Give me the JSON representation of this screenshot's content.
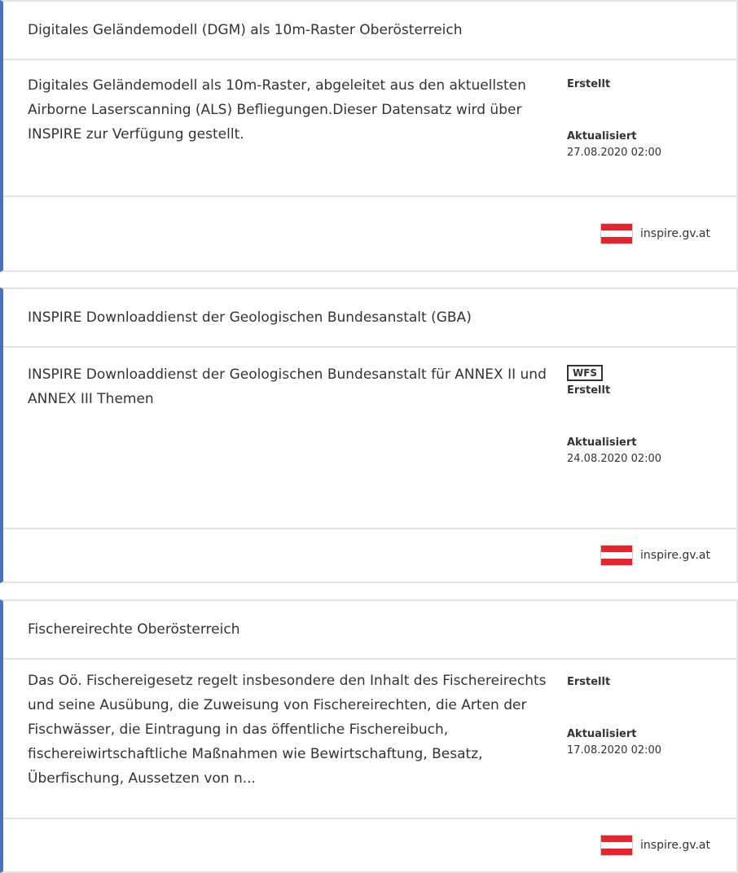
{
  "cards": [
    {
      "title": "Digitales Geländemodell (DGM) als 10m-Raster Oberösterreich",
      "description": "Digitales Geländemodell als 10m-Raster, abgeleitet aus den aktuellsten Airborne Laserscanning (ALS) Befliegungen.Dieser Datensatz wird über INSPIRE zur Verfügung gestellt.",
      "badge": "",
      "created_label": "Erstellt",
      "created_value": "",
      "updated_label": "Aktualisiert",
      "updated_value": "27.08.2020 02:00",
      "source": "inspire.gv.at",
      "flag_icon": "austria-flag-icon"
    },
    {
      "title": "INSPIRE Downloaddienst der Geologischen Bundesanstalt (GBA)",
      "description": "INSPIRE Downloaddienst der Geologischen Bundesanstalt für ANNEX II und ANNEX III Themen",
      "badge": "WFS",
      "created_label": "Erstellt",
      "created_value": "",
      "updated_label": "Aktualisiert",
      "updated_value": "24.08.2020 02:00",
      "source": "inspire.gv.at",
      "flag_icon": "austria-flag-icon"
    },
    {
      "title": "Fischereirechte Oberösterreich",
      "description": "Das Oö. Fischereigesetz regelt insbesondere den Inhalt des Fischereirechts und seine Ausübung, die Zuweisung von Fischereirechten, die Arten der Fischwässer, die Eintragung in das öffentliche Fischereibuch, fischereiwirtschaftliche Maßnahmen wie Bewirtschaftung, Besatz, Überfischung, Aussetzen von n...",
      "badge": "",
      "created_label": "Erstellt",
      "created_value": "",
      "updated_label": "Aktualisiert",
      "updated_value": "17.08.2020 02:00",
      "source": "inspire.gv.at",
      "flag_icon": "austria-flag-icon"
    }
  ],
  "colors": {
    "accent_border": "#4a72c0",
    "divider": "#e3e3e3",
    "flag_red": "#e5242d",
    "text": "#333333"
  }
}
